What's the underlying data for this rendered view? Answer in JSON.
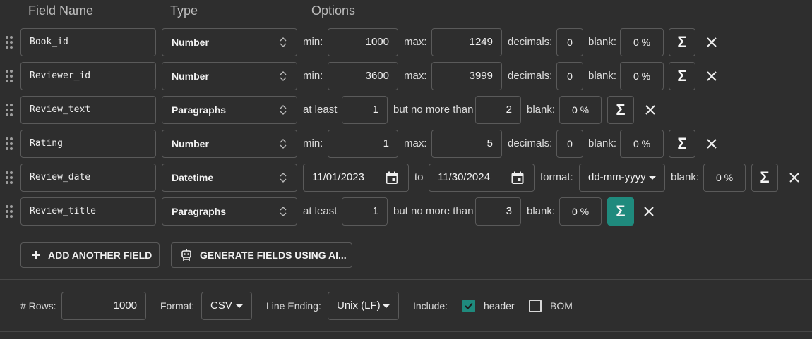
{
  "headers": {
    "field_name": "Field Name",
    "type": "Type",
    "options": "Options"
  },
  "rows": [
    {
      "name": "Book_id",
      "type": "Number",
      "min_label": "min:",
      "min": "1000",
      "max_label": "max:",
      "max": "1249",
      "decimals_label": "decimals:",
      "decimals": "0",
      "blank_label": "blank:",
      "blank": "0 %"
    },
    {
      "name": "Reviewer_id",
      "type": "Number",
      "min_label": "min:",
      "min": "3600",
      "max_label": "max:",
      "max": "3999",
      "decimals_label": "decimals:",
      "decimals": "0",
      "blank_label": "blank:",
      "blank": "0 %"
    },
    {
      "name": "Review_text",
      "type": "Paragraphs",
      "atleast_label": "at least",
      "atleast": "1",
      "nomore_label": "but no more than",
      "nomore": "2",
      "blank_label": "blank:",
      "blank": "0 %"
    },
    {
      "name": "Rating",
      "type": "Number",
      "min_label": "min:",
      "min": "1",
      "max_label": "max:",
      "max": "5",
      "decimals_label": "decimals:",
      "decimals": "0",
      "blank_label": "blank:",
      "blank": "0 %"
    },
    {
      "name": "Review_date",
      "type": "Datetime",
      "from": "11/01/2023",
      "to_label": "to",
      "to": "11/30/2024",
      "format_label": "format:",
      "format": "dd-mm-yyyy",
      "blank_label": "blank:",
      "blank": "0 %"
    },
    {
      "name": "Review_title",
      "type": "Paragraphs",
      "atleast_label": "at least",
      "atleast": "1",
      "nomore_label": "but no more than",
      "nomore": "3",
      "blank_label": "blank:",
      "blank": "0 %"
    }
  ],
  "icons": {
    "sigma": "Σ",
    "remove": "close-icon",
    "drag": "drag-handle-icon",
    "updown": "unfold-icon",
    "calendar": "calendar-icon",
    "add": "plus-icon",
    "ai": "robot-icon"
  },
  "actions": {
    "add_field": "ADD ANOTHER FIELD",
    "generate_ai": "GENERATE FIELDS USING AI..."
  },
  "footer": {
    "rows_label": "# Rows:",
    "rows_value": "1000",
    "format_label": "Format:",
    "format_value": "CSV",
    "line_ending_label": "Line Ending:",
    "line_ending_value": "Unix (LF)",
    "include_label": "Include:",
    "header_label": "header",
    "header_checked": true,
    "bom_label": "BOM",
    "bom_checked": false
  },
  "colors": {
    "accent": "#1f8a7d",
    "background": "#2e2e2e",
    "border": "#5a5a5a"
  }
}
